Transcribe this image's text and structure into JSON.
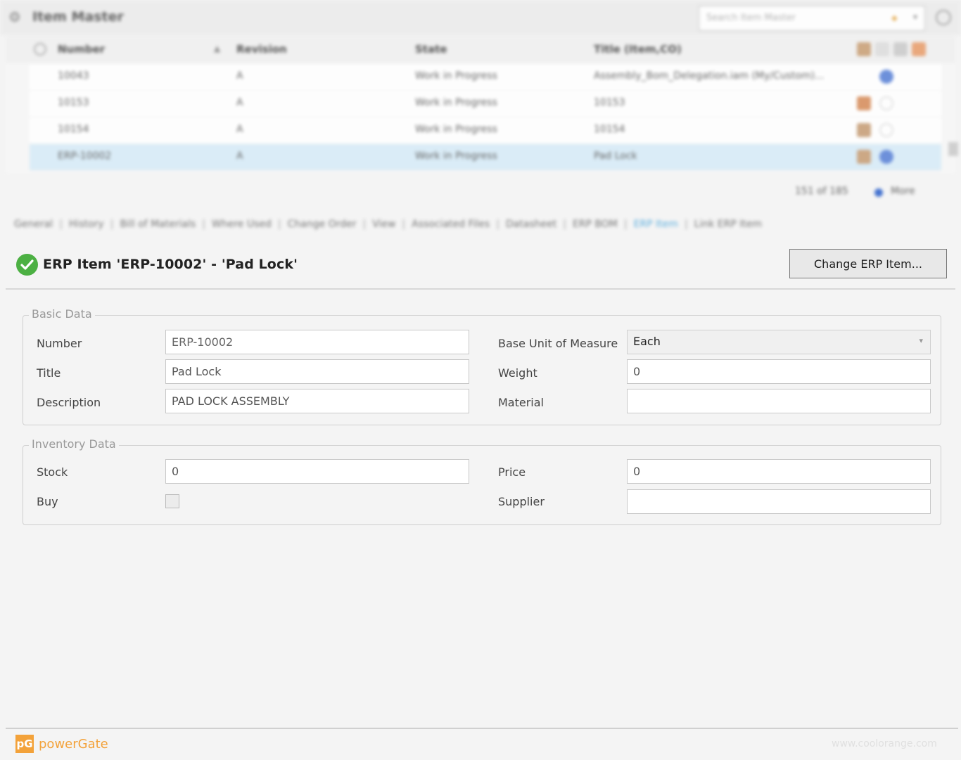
{
  "window": {
    "title": "Item Master",
    "search_placeholder": "Search Item Master"
  },
  "grid": {
    "columns": [
      "Number",
      "Revision",
      "State",
      "Title (Item,CO)"
    ],
    "rows": [
      {
        "number": "10043",
        "revision": "A",
        "state": "Work in Progress",
        "title": "Assembly_Bom_Delegation.iam (My/Custom)..."
      },
      {
        "number": "10153",
        "revision": "A",
        "state": "Work in Progress",
        "title": "10153"
      },
      {
        "number": "10154",
        "revision": "A",
        "state": "Work in Progress",
        "title": "10154"
      },
      {
        "number": "ERP-10002",
        "revision": "A",
        "state": "Work in Progress",
        "title": "Pad Lock"
      }
    ],
    "pager": "151 of 185",
    "more": "More"
  },
  "tabs": [
    "General",
    "History",
    "Bill of Materials",
    "Where Used",
    "Change Order",
    "View",
    "Associated Files",
    "Datasheet",
    "ERP BOM",
    "ERP Item",
    "Link ERP Item"
  ],
  "active_tab": "ERP Item",
  "header": {
    "title": "ERP Item 'ERP-10002' - 'Pad Lock'",
    "change_button": "Change ERP Item..."
  },
  "basic": {
    "legend": "Basic Data",
    "number_label": "Number",
    "number_value": "ERP-10002",
    "title_label": "Title",
    "title_value": "Pad Lock",
    "description_label": "Description",
    "description_value": "PAD LOCK ASSEMBLY",
    "uom_label": "Base Unit of Measure",
    "uom_value": "Each",
    "weight_label": "Weight",
    "weight_value": "0",
    "material_label": "Material",
    "material_value": ""
  },
  "inventory": {
    "legend": "Inventory Data",
    "stock_label": "Stock",
    "stock_value": "0",
    "buy_label": "Buy",
    "buy_checked": false,
    "price_label": "Price",
    "price_value": "0",
    "supplier_label": "Supplier",
    "supplier_value": ""
  },
  "footer": {
    "brand": "powerGate",
    "logo": "pG",
    "url": "www.coolorange.com"
  }
}
